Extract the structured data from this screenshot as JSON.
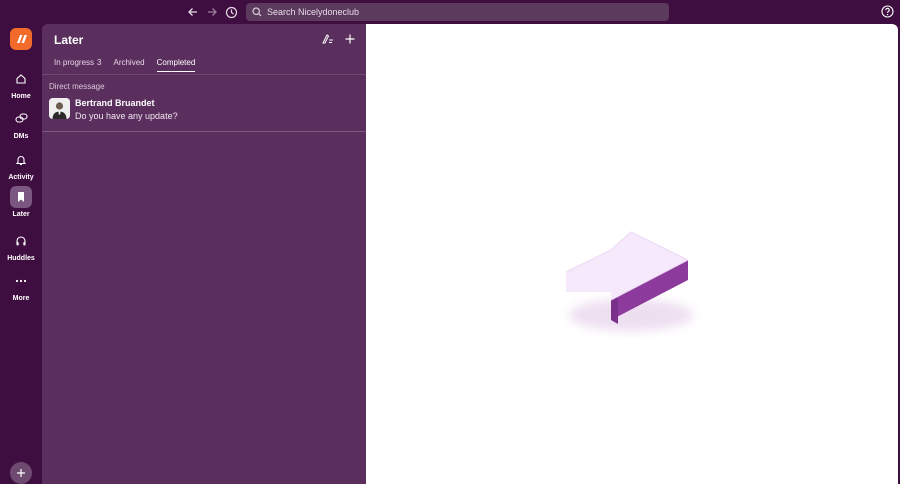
{
  "topbar": {
    "search_placeholder": "Search Nicelydoneclub",
    "icons": [
      "back-arrow-icon",
      "forward-arrow-icon",
      "history-icon",
      "search-icon",
      "help-icon"
    ]
  },
  "rail": {
    "items": [
      {
        "label": "Home",
        "icon": "home-icon"
      },
      {
        "label": "DMs",
        "icon": "dms-icon"
      },
      {
        "label": "Activity",
        "icon": "bell-icon"
      },
      {
        "label": "Later",
        "icon": "bookmark-icon",
        "active": true
      },
      {
        "label": "Huddles",
        "icon": "headphones-icon"
      },
      {
        "label": "More",
        "icon": "more-icon"
      }
    ]
  },
  "panel": {
    "title": "Later",
    "tabs": [
      {
        "label": "In progress",
        "count": "3"
      },
      {
        "label": "Archived"
      },
      {
        "label": "Completed",
        "active": true
      }
    ],
    "section_label": "Direct message",
    "item": {
      "name": "Bertrand Bruandet",
      "message": "Do you have any update?"
    }
  },
  "colors": {
    "sidebar": "#3f0e40",
    "panel": "#5a2e5d",
    "accent": "#f26b2b",
    "illustration": "#a24bb0"
  }
}
